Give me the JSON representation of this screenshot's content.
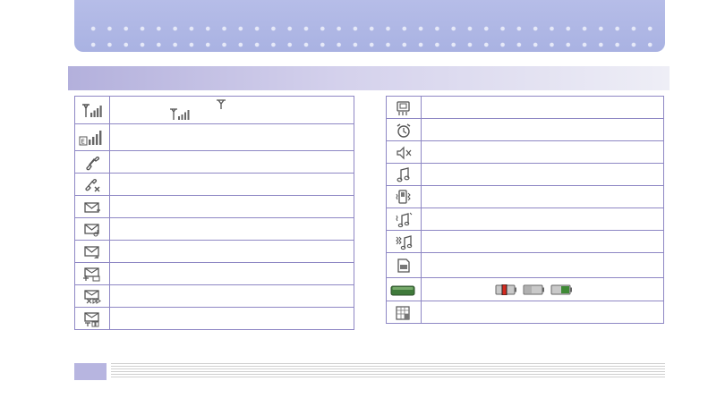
{
  "left_rows": [
    {
      "icon": "signal-strength-icon"
    },
    {
      "icon": "edge-signal-icon"
    },
    {
      "icon": "call-in-progress-icon"
    },
    {
      "icon": "missed-call-icon"
    },
    {
      "icon": "new-message-icon"
    },
    {
      "icon": "new-voicemail-icon"
    },
    {
      "icon": "email-message-icon"
    },
    {
      "icon": "multimedia-message-icon"
    },
    {
      "icon": "message-rejected-icon"
    },
    {
      "icon": "message-sending-icon"
    }
  ],
  "right_rows": [
    {
      "icon": "sim-tool-icon"
    },
    {
      "icon": "alarm-icon"
    },
    {
      "icon": "silent-mode-icon"
    },
    {
      "icon": "ring-mode-icon"
    },
    {
      "icon": "vibration-mode-icon"
    },
    {
      "icon": "ring-and-vibrate-icon"
    },
    {
      "icon": "vibrate-then-ring-icon"
    },
    {
      "icon": "memory-card-icon"
    },
    {
      "icon": "battery-level-icon"
    },
    {
      "icon": "calendar-icon"
    }
  ],
  "colors": {
    "border": "#8e87c4",
    "banner": "#b6bde8",
    "section_bar": "#b3b0dc",
    "battery_green": "#3f7a3a"
  }
}
